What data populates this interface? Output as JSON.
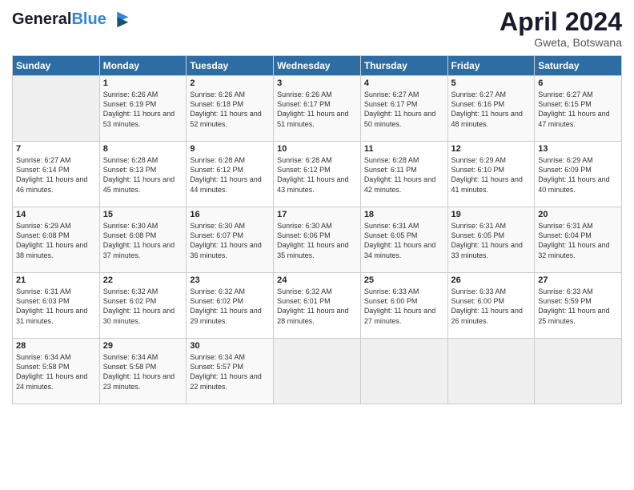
{
  "header": {
    "logo_line1": "General",
    "logo_line2": "Blue",
    "month": "April 2024",
    "location": "Gweta, Botswana"
  },
  "columns": [
    "Sunday",
    "Monday",
    "Tuesday",
    "Wednesday",
    "Thursday",
    "Friday",
    "Saturday"
  ],
  "weeks": [
    [
      {
        "day": "",
        "sunrise": "",
        "sunset": "",
        "daylight": "",
        "empty": true
      },
      {
        "day": "1",
        "sunrise": "Sunrise: 6:26 AM",
        "sunset": "Sunset: 6:19 PM",
        "daylight": "Daylight: 11 hours and 53 minutes."
      },
      {
        "day": "2",
        "sunrise": "Sunrise: 6:26 AM",
        "sunset": "Sunset: 6:18 PM",
        "daylight": "Daylight: 11 hours and 52 minutes."
      },
      {
        "day": "3",
        "sunrise": "Sunrise: 6:26 AM",
        "sunset": "Sunset: 6:17 PM",
        "daylight": "Daylight: 11 hours and 51 minutes."
      },
      {
        "day": "4",
        "sunrise": "Sunrise: 6:27 AM",
        "sunset": "Sunset: 6:17 PM",
        "daylight": "Daylight: 11 hours and 50 minutes."
      },
      {
        "day": "5",
        "sunrise": "Sunrise: 6:27 AM",
        "sunset": "Sunset: 6:16 PM",
        "daylight": "Daylight: 11 hours and 48 minutes."
      },
      {
        "day": "6",
        "sunrise": "Sunrise: 6:27 AM",
        "sunset": "Sunset: 6:15 PM",
        "daylight": "Daylight: 11 hours and 47 minutes."
      }
    ],
    [
      {
        "day": "7",
        "sunrise": "Sunrise: 6:27 AM",
        "sunset": "Sunset: 6:14 PM",
        "daylight": "Daylight: 11 hours and 46 minutes."
      },
      {
        "day": "8",
        "sunrise": "Sunrise: 6:28 AM",
        "sunset": "Sunset: 6:13 PM",
        "daylight": "Daylight: 11 hours and 45 minutes."
      },
      {
        "day": "9",
        "sunrise": "Sunrise: 6:28 AM",
        "sunset": "Sunset: 6:12 PM",
        "daylight": "Daylight: 11 hours and 44 minutes."
      },
      {
        "day": "10",
        "sunrise": "Sunrise: 6:28 AM",
        "sunset": "Sunset: 6:12 PM",
        "daylight": "Daylight: 11 hours and 43 minutes."
      },
      {
        "day": "11",
        "sunrise": "Sunrise: 6:28 AM",
        "sunset": "Sunset: 6:11 PM",
        "daylight": "Daylight: 11 hours and 42 minutes."
      },
      {
        "day": "12",
        "sunrise": "Sunrise: 6:29 AM",
        "sunset": "Sunset: 6:10 PM",
        "daylight": "Daylight: 11 hours and 41 minutes."
      },
      {
        "day": "13",
        "sunrise": "Sunrise: 6:29 AM",
        "sunset": "Sunset: 6:09 PM",
        "daylight": "Daylight: 11 hours and 40 minutes."
      }
    ],
    [
      {
        "day": "14",
        "sunrise": "Sunrise: 6:29 AM",
        "sunset": "Sunset: 6:08 PM",
        "daylight": "Daylight: 11 hours and 38 minutes."
      },
      {
        "day": "15",
        "sunrise": "Sunrise: 6:30 AM",
        "sunset": "Sunset: 6:08 PM",
        "daylight": "Daylight: 11 hours and 37 minutes."
      },
      {
        "day": "16",
        "sunrise": "Sunrise: 6:30 AM",
        "sunset": "Sunset: 6:07 PM",
        "daylight": "Daylight: 11 hours and 36 minutes."
      },
      {
        "day": "17",
        "sunrise": "Sunrise: 6:30 AM",
        "sunset": "Sunset: 6:06 PM",
        "daylight": "Daylight: 11 hours and 35 minutes."
      },
      {
        "day": "18",
        "sunrise": "Sunrise: 6:31 AM",
        "sunset": "Sunset: 6:05 PM",
        "daylight": "Daylight: 11 hours and 34 minutes."
      },
      {
        "day": "19",
        "sunrise": "Sunrise: 6:31 AM",
        "sunset": "Sunset: 6:05 PM",
        "daylight": "Daylight: 11 hours and 33 minutes."
      },
      {
        "day": "20",
        "sunrise": "Sunrise: 6:31 AM",
        "sunset": "Sunset: 6:04 PM",
        "daylight": "Daylight: 11 hours and 32 minutes."
      }
    ],
    [
      {
        "day": "21",
        "sunrise": "Sunrise: 6:31 AM",
        "sunset": "Sunset: 6:03 PM",
        "daylight": "Daylight: 11 hours and 31 minutes."
      },
      {
        "day": "22",
        "sunrise": "Sunrise: 6:32 AM",
        "sunset": "Sunset: 6:02 PM",
        "daylight": "Daylight: 11 hours and 30 minutes."
      },
      {
        "day": "23",
        "sunrise": "Sunrise: 6:32 AM",
        "sunset": "Sunset: 6:02 PM",
        "daylight": "Daylight: 11 hours and 29 minutes."
      },
      {
        "day": "24",
        "sunrise": "Sunrise: 6:32 AM",
        "sunset": "Sunset: 6:01 PM",
        "daylight": "Daylight: 11 hours and 28 minutes."
      },
      {
        "day": "25",
        "sunrise": "Sunrise: 6:33 AM",
        "sunset": "Sunset: 6:00 PM",
        "daylight": "Daylight: 11 hours and 27 minutes."
      },
      {
        "day": "26",
        "sunrise": "Sunrise: 6:33 AM",
        "sunset": "Sunset: 6:00 PM",
        "daylight": "Daylight: 11 hours and 26 minutes."
      },
      {
        "day": "27",
        "sunrise": "Sunrise: 6:33 AM",
        "sunset": "Sunset: 5:59 PM",
        "daylight": "Daylight: 11 hours and 25 minutes."
      }
    ],
    [
      {
        "day": "28",
        "sunrise": "Sunrise: 6:34 AM",
        "sunset": "Sunset: 5:58 PM",
        "daylight": "Daylight: 11 hours and 24 minutes."
      },
      {
        "day": "29",
        "sunrise": "Sunrise: 6:34 AM",
        "sunset": "Sunset: 5:58 PM",
        "daylight": "Daylight: 11 hours and 23 minutes."
      },
      {
        "day": "30",
        "sunrise": "Sunrise: 6:34 AM",
        "sunset": "Sunset: 5:57 PM",
        "daylight": "Daylight: 11 hours and 22 minutes."
      },
      {
        "day": "",
        "sunrise": "",
        "sunset": "",
        "daylight": "",
        "empty": true
      },
      {
        "day": "",
        "sunrise": "",
        "sunset": "",
        "daylight": "",
        "empty": true
      },
      {
        "day": "",
        "sunrise": "",
        "sunset": "",
        "daylight": "",
        "empty": true
      },
      {
        "day": "",
        "sunrise": "",
        "sunset": "",
        "daylight": "",
        "empty": true
      }
    ]
  ]
}
